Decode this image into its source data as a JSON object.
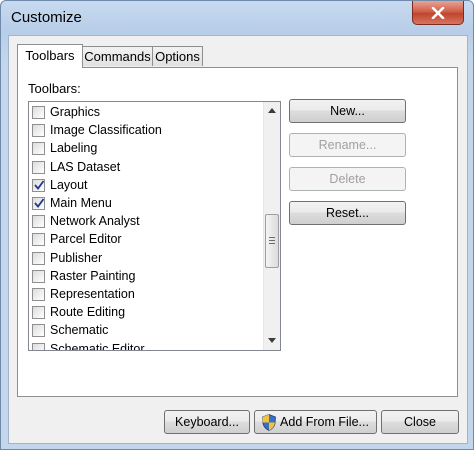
{
  "window": {
    "title": "Customize"
  },
  "tabs": [
    {
      "label": "Toolbars"
    },
    {
      "label": "Commands"
    },
    {
      "label": "Options"
    }
  ],
  "panel": {
    "label": "Toolbars:"
  },
  "toolbars": [
    {
      "label": "Graphics",
      "checked": false
    },
    {
      "label": "Image Classification",
      "checked": false
    },
    {
      "label": "Labeling",
      "checked": false
    },
    {
      "label": "LAS Dataset",
      "checked": false
    },
    {
      "label": "Layout",
      "checked": true
    },
    {
      "label": "Main Menu",
      "checked": true
    },
    {
      "label": "Network Analyst",
      "checked": false
    },
    {
      "label": "Parcel Editor",
      "checked": false
    },
    {
      "label": "Publisher",
      "checked": false
    },
    {
      "label": "Raster Painting",
      "checked": false
    },
    {
      "label": "Representation",
      "checked": false
    },
    {
      "label": "Route Editing",
      "checked": false
    },
    {
      "label": "Schematic",
      "checked": false
    },
    {
      "label": "Schematic Editor",
      "checked": false
    }
  ],
  "side_buttons": {
    "new": "New...",
    "rename": "Rename...",
    "delete": "Delete",
    "reset": "Reset..."
  },
  "footer": {
    "keyboard": "Keyboard...",
    "add_from_file": "Add From File...",
    "close": "Close"
  },
  "icons": {
    "close": "close-icon",
    "check": "checkmark-icon",
    "scroll_up": "scroll-up-arrow-icon",
    "scroll_down": "scroll-down-arrow-icon",
    "shield": "uac-shield-icon"
  }
}
